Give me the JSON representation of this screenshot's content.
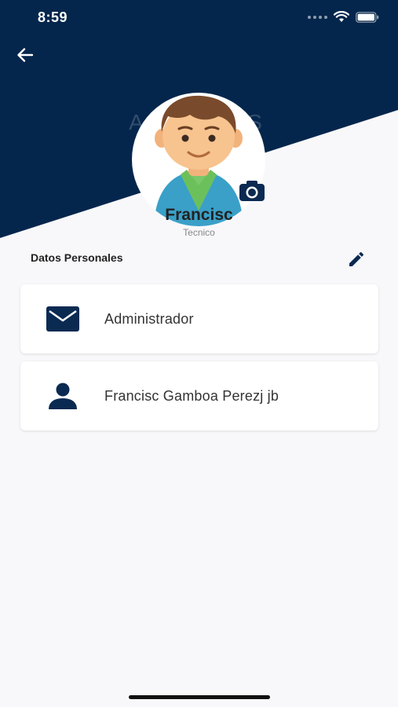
{
  "colors": {
    "header": "#05264c",
    "accent": "#0a2a52",
    "background": "#f8f8fa"
  },
  "status_bar": {
    "time": "8:59",
    "icons": [
      "signal-dots-icon",
      "wifi-icon",
      "battery-icon"
    ]
  },
  "header": {
    "back_icon": "arrow-left-icon",
    "brand_watermark": "AVE    VAS"
  },
  "profile": {
    "name": "Francisc",
    "role": "Tecnico",
    "avatar_icon": "avatar-illustration",
    "camera_icon": "camera-icon"
  },
  "section": {
    "title": "Datos Personales",
    "edit_icon": "pencil-icon"
  },
  "cards": [
    {
      "icon": "mail-icon",
      "text": "Administrador"
    },
    {
      "icon": "person-icon",
      "text": "Francisc Gamboa Perezj jb"
    }
  ]
}
